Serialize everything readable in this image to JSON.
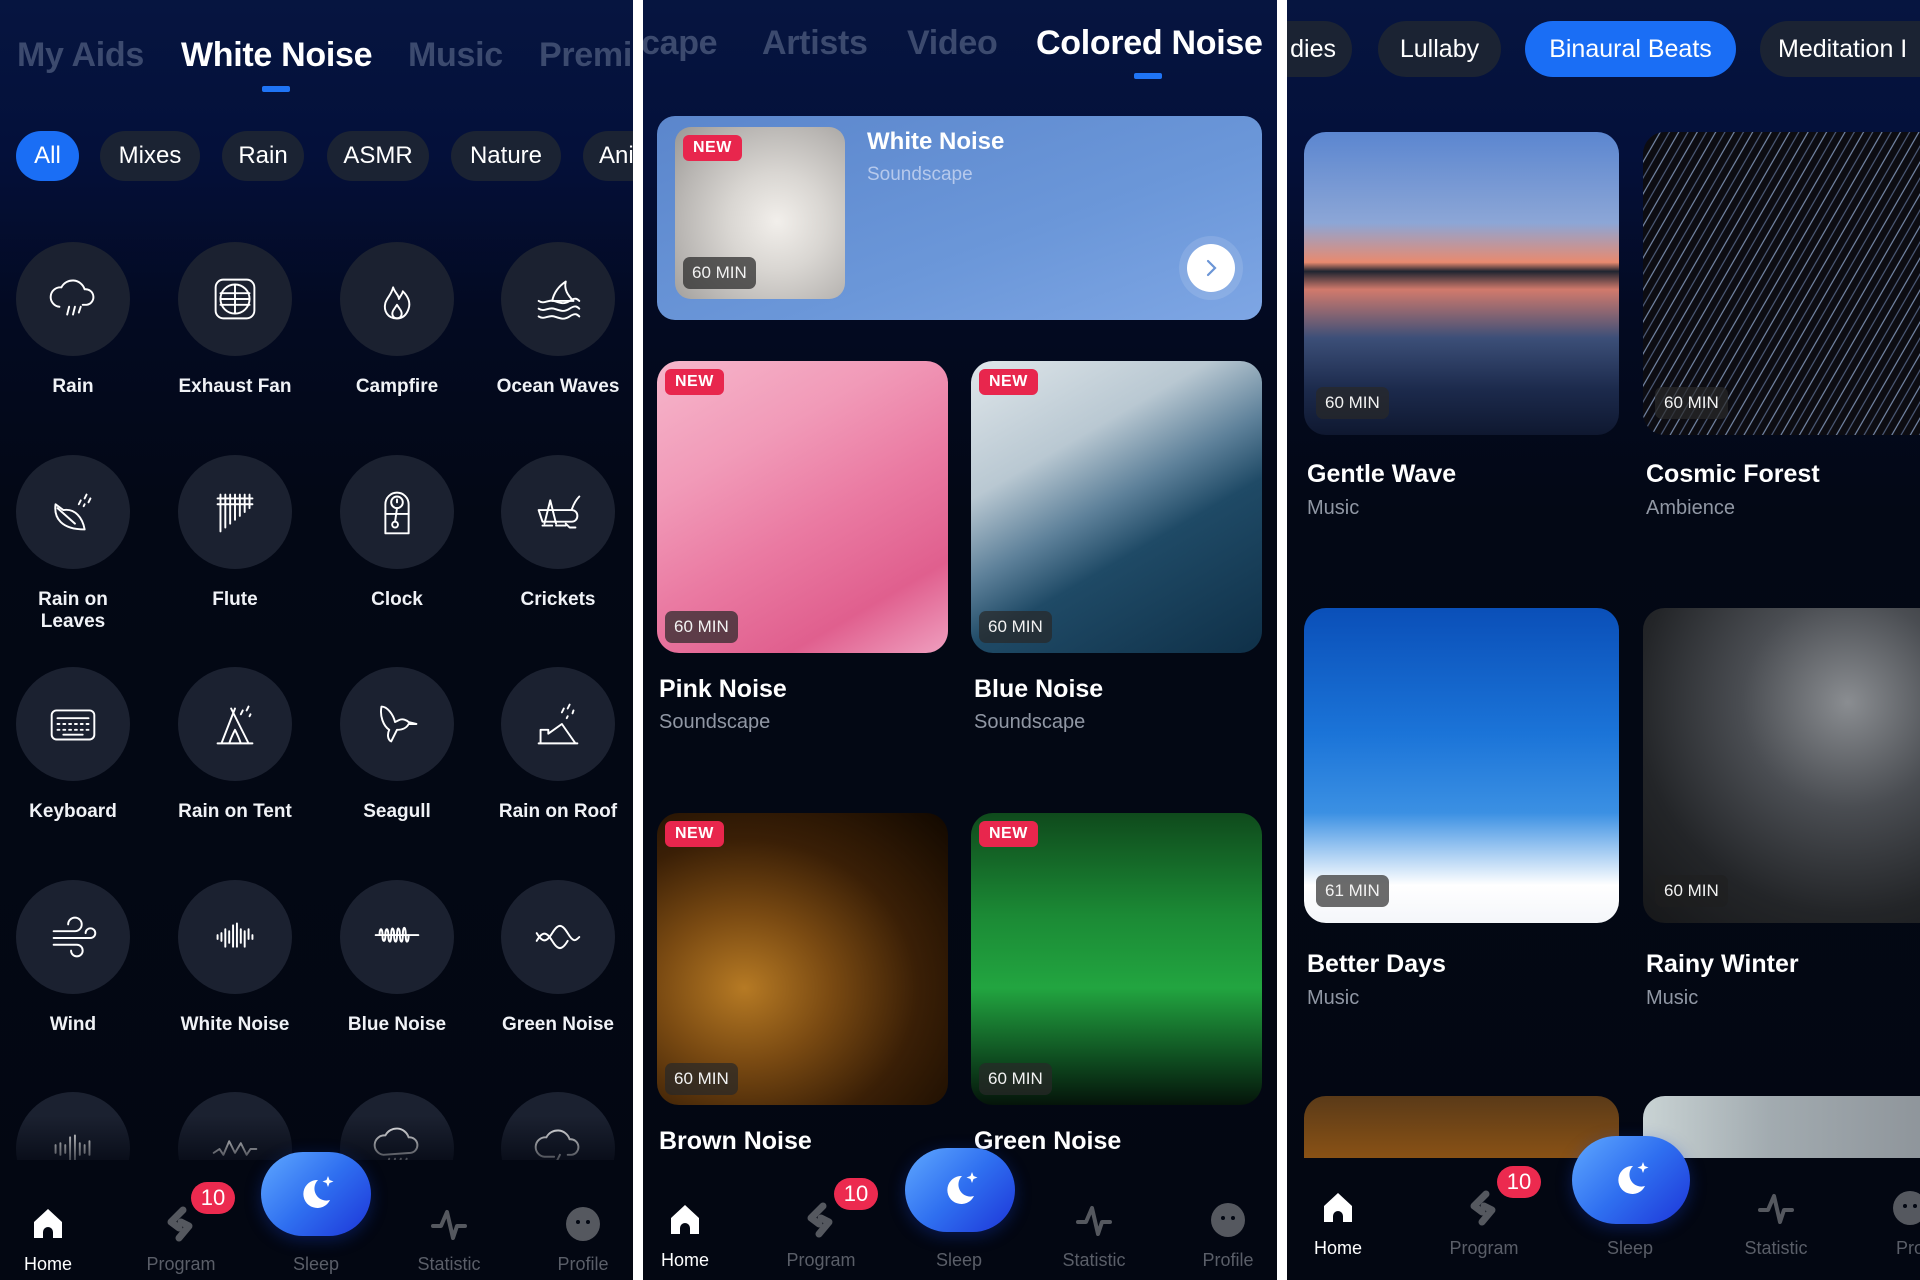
{
  "panel1": {
    "tabs": [
      {
        "label": "My Aids",
        "active": false
      },
      {
        "label": "White Noise",
        "active": true
      },
      {
        "label": "Music",
        "active": false
      },
      {
        "label": "Premi",
        "active": false
      }
    ],
    "chips": [
      {
        "label": "All",
        "active": true
      },
      {
        "label": "Mixes",
        "active": false
      },
      {
        "label": "Rain",
        "active": false
      },
      {
        "label": "ASMR",
        "active": false
      },
      {
        "label": "Nature",
        "active": false
      },
      {
        "label": "Ani",
        "active": false
      }
    ],
    "sounds": [
      {
        "label": "Rain",
        "icon": "rain-cloud-icon"
      },
      {
        "label": "Exhaust Fan",
        "icon": "exhaust-fan-icon"
      },
      {
        "label": "Campfire",
        "icon": "fire-icon"
      },
      {
        "label": "Ocean Waves",
        "icon": "ocean-waves-icon"
      },
      {
        "label": "Rain on Leaves",
        "icon": "leaf-rain-icon"
      },
      {
        "label": "Flute",
        "icon": "pan-flute-icon"
      },
      {
        "label": "Clock",
        "icon": "pendulum-clock-icon"
      },
      {
        "label": "Crickets",
        "icon": "cricket-icon"
      },
      {
        "label": "Keyboard",
        "icon": "keyboard-icon"
      },
      {
        "label": "Rain on Tent",
        "icon": "tent-rain-icon"
      },
      {
        "label": "Seagull",
        "icon": "bird-icon"
      },
      {
        "label": "Rain on Roof",
        "icon": "roof-rain-icon"
      },
      {
        "label": "Wind",
        "icon": "wind-icon"
      },
      {
        "label": "White Noise",
        "icon": "soundwave-icon"
      },
      {
        "label": "Blue Noise",
        "icon": "sine-wave-icon"
      },
      {
        "label": "Green Noise",
        "icon": "crossing-waves-icon"
      },
      {
        "label": "",
        "icon": "equalizer-bars-icon"
      },
      {
        "label": "",
        "icon": "zigzag-wave-icon"
      },
      {
        "label": "",
        "icon": "heavy-rain-cloud-icon"
      },
      {
        "label": "",
        "icon": "thunder-cloud-icon"
      }
    ]
  },
  "panel2": {
    "tabs": [
      {
        "label": "cape",
        "active": false
      },
      {
        "label": "Artists",
        "active": false
      },
      {
        "label": "Video",
        "active": false
      },
      {
        "label": "Colored Noise",
        "active": true
      }
    ],
    "featured": {
      "title": "White Noise",
      "subtitle": "Soundscape",
      "badge": "NEW",
      "duration": "60 MIN"
    },
    "cards": [
      {
        "title": "Pink Noise",
        "subtitle": "Soundscape",
        "badge": "NEW",
        "duration": "60 MIN"
      },
      {
        "title": "Blue Noise",
        "subtitle": "Soundscape",
        "badge": "NEW",
        "duration": "60 MIN"
      },
      {
        "title": "Brown Noise",
        "subtitle": "",
        "badge": "NEW",
        "duration": "60 MIN"
      },
      {
        "title": "Green Noise",
        "subtitle": "",
        "badge": "NEW",
        "duration": "60 MIN"
      }
    ]
  },
  "panel3": {
    "chips": [
      {
        "label": "dies",
        "active": false
      },
      {
        "label": "Lullaby",
        "active": false
      },
      {
        "label": "Binaural Beats",
        "active": true
      },
      {
        "label": "Meditation I",
        "active": false
      }
    ],
    "cards": [
      {
        "title": "Gentle Wave",
        "subtitle": "Music",
        "duration": "60 MIN"
      },
      {
        "title": "Cosmic Forest",
        "subtitle": "Ambience",
        "duration": "60 MIN"
      },
      {
        "title": "Better Days",
        "subtitle": "Music",
        "duration": "61 MIN"
      },
      {
        "title": "Rainy Winter",
        "subtitle": "Music",
        "duration": "60 MIN"
      }
    ]
  },
  "nav": {
    "items": [
      {
        "label": "Home",
        "icon": "home-icon",
        "active": true
      },
      {
        "label": "Program",
        "icon": "program-icon",
        "badge": "10"
      },
      {
        "label": "Sleep",
        "icon": "moon-star-icon"
      },
      {
        "label": "Statistic",
        "icon": "pulse-icon"
      },
      {
        "label": "Profile",
        "icon": "profile-face-icon"
      }
    ],
    "partial_profile_label": "Pro"
  },
  "colors": {
    "accent": "#1a6ef5",
    "badge_red": "#e8264d",
    "background": "#030712",
    "chip_bg": "#1b2333",
    "inactive_tab": "#3c4a6e"
  }
}
